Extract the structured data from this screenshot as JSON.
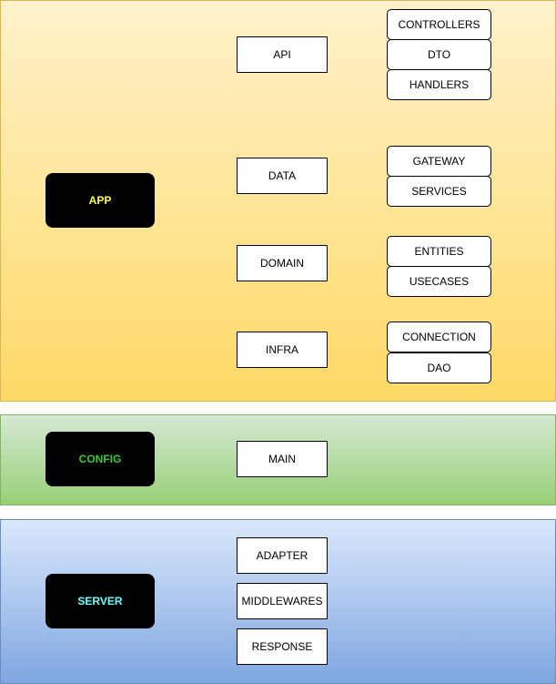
{
  "colors": {
    "app_text": "#ffff33",
    "config_text": "#33cc33",
    "server_text": "#66ffff"
  },
  "app": {
    "label": "APP",
    "modules": [
      {
        "label": "API",
        "children": [
          "CONTROLLERS",
          "DTO",
          "HANDLERS"
        ]
      },
      {
        "label": "DATA",
        "children": [
          "GATEWAY",
          "SERVICES"
        ]
      },
      {
        "label": "DOMAIN",
        "children": [
          "ENTITIES",
          "USECASES"
        ]
      },
      {
        "label": "INFRA",
        "children": [
          "CONNECTION",
          "DAO"
        ]
      }
    ]
  },
  "config": {
    "label": "CONFIG",
    "modules": [
      {
        "label": "MAIN"
      }
    ]
  },
  "server": {
    "label": "SERVER",
    "modules": [
      {
        "label": "ADAPTER"
      },
      {
        "label": "MIDDLEWARES"
      },
      {
        "label": "RESPONSE"
      }
    ]
  }
}
